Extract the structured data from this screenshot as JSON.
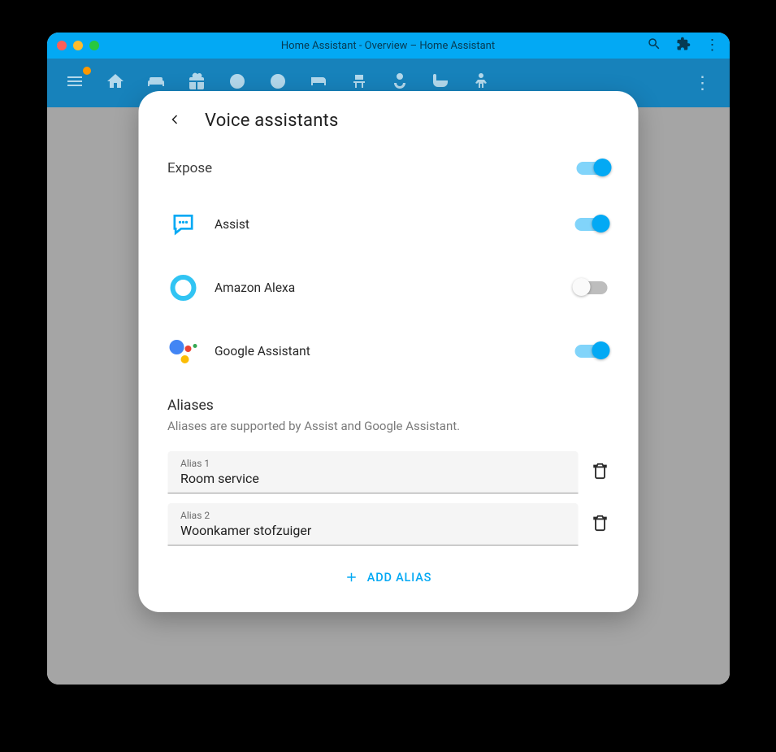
{
  "window": {
    "title": "Home Assistant - Overview – Home Assistant"
  },
  "dialog": {
    "title": "Voice assistants",
    "expose": {
      "label": "Expose",
      "on": true
    },
    "assistants": [
      {
        "id": "assist",
        "label": "Assist",
        "on": true
      },
      {
        "id": "alexa",
        "label": "Amazon Alexa",
        "on": false
      },
      {
        "id": "google",
        "label": "Google Assistant",
        "on": true
      }
    ],
    "aliases": {
      "heading": "Aliases",
      "sub": "Aliases are supported by Assist and Google Assistant.",
      "items": [
        {
          "label": "Alias 1",
          "value": "Room service"
        },
        {
          "label": "Alias 2",
          "value": "Woonkamer stofzuiger"
        }
      ],
      "add_label": "ADD ALIAS"
    }
  }
}
